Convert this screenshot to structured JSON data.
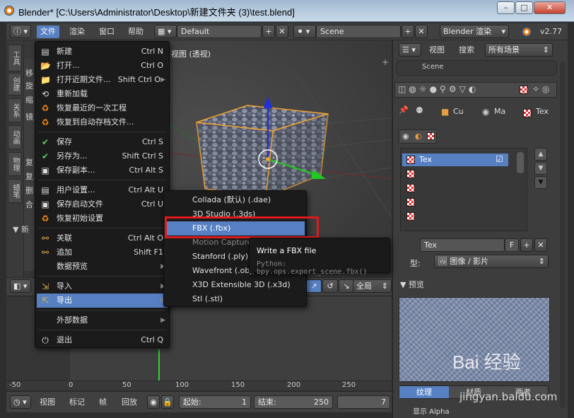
{
  "window": {
    "title": "Blender* [C:\\Users\\Administrator\\Desktop\\新建文件夹 (3)\\test.blend]",
    "min_label": "–",
    "max_label": "□",
    "close_label": "✕"
  },
  "header": {
    "menus": [
      "文件",
      "渲染",
      "窗口",
      "帮助"
    ],
    "layout_name": "Default",
    "scene_name": "Scene",
    "engine": "Blender 渲染",
    "version": "v2.77"
  },
  "left_tabs": [
    "工具",
    "创建",
    "关系",
    "动画",
    "物理",
    "蜡笔"
  ],
  "viewport": {
    "label": "视图 (透视)",
    "bg_items": [
      "移",
      "旋",
      "缩",
      "镜",
      "复",
      "复",
      "删",
      "合"
    ],
    "section_label": "▼ 新"
  },
  "file_menu": {
    "items": [
      {
        "label": "新建",
        "shortcut": "Ctrl N",
        "icon": "new-file-icon"
      },
      {
        "label": "打开...",
        "shortcut": "Ctrl O",
        "icon": "open-folder-icon"
      },
      {
        "label": "打开近期文件...",
        "shortcut": "Shift Ctrl O",
        "icon": "recent-files-icon",
        "submenu": true
      },
      {
        "label": "重新加载",
        "shortcut": "",
        "icon": "reload-icon"
      },
      {
        "label": "恢复最近的一次工程",
        "shortcut": "",
        "icon": "recover-icon"
      },
      {
        "label": "恢复到自动存档文件...",
        "shortcut": "",
        "icon": "recover-auto-icon"
      },
      {
        "label": "保存",
        "shortcut": "Ctrl S",
        "icon": "checkmark-icon"
      },
      {
        "label": "另存为...",
        "shortcut": "Shift Ctrl S",
        "icon": "checkmark-icon"
      },
      {
        "label": "保存副本...",
        "shortcut": "Ctrl Alt S",
        "icon": "save-copy-icon"
      },
      {
        "label": "用户设置...",
        "shortcut": "Ctrl Alt U",
        "icon": "preferences-icon"
      },
      {
        "label": "保存启动文件",
        "shortcut": "Ctrl U",
        "icon": "save-startup-icon"
      },
      {
        "label": "恢复初始设置",
        "shortcut": "",
        "icon": "factory-settings-icon"
      },
      {
        "label": "关联",
        "shortcut": "Ctrl Alt O",
        "icon": "link-icon"
      },
      {
        "label": "追加",
        "shortcut": "Shift F1",
        "icon": "append-icon"
      },
      {
        "label": "数据预览",
        "shortcut": "",
        "icon": "",
        "submenu": true
      },
      {
        "label": "导入",
        "shortcut": "",
        "icon": "import-icon",
        "submenu": true
      },
      {
        "label": "导出",
        "shortcut": "",
        "icon": "export-icon",
        "submenu": true,
        "active": true
      },
      {
        "label": "外部数据",
        "shortcut": "",
        "icon": "",
        "submenu": true
      },
      {
        "label": "退出",
        "shortcut": "Ctrl Q",
        "icon": "quit-icon"
      }
    ]
  },
  "export_menu": {
    "items": [
      {
        "label": "Collada (默认) (.dae)"
      },
      {
        "label": "3D Studio (.3ds)"
      },
      {
        "label": "FBX (.fbx)",
        "active": true
      },
      {
        "label": "Motion Capture (.bvh)",
        "disabled": true
      },
      {
        "label": "Stanford (.ply)"
      },
      {
        "label": "Wavefront (.obj)"
      },
      {
        "label": "X3D Extensible 3D (.x3d)"
      },
      {
        "label": "Stl (.stl)"
      }
    ]
  },
  "tooltip": {
    "title": "Write a FBX file",
    "python": "Python: bpy.ops.export_scene.fbx()"
  },
  "viewport_header": {
    "mode": "全局"
  },
  "timeline": {
    "ruler_ticks": [
      "-50",
      "0",
      "50",
      "100",
      "150",
      "200",
      "250"
    ],
    "footer_menus": [
      "视图",
      "标记",
      "帧",
      "回放"
    ],
    "start_label": "起始:",
    "start_value": "1",
    "end_label": "结束:",
    "end_value": "250",
    "current_frame": "7"
  },
  "properties": {
    "header_menus": [
      "视图",
      "搜索"
    ],
    "filter": "所有场景",
    "scene_item": "Scene",
    "breadcrumb": [
      "Cu",
      "Ma",
      "Tex"
    ],
    "texture_slot": "Tex",
    "texture_name": "Tex",
    "fake_user": "F",
    "type_label": "型:",
    "type_value": "图像 / 影片",
    "preview_label": "▼ 预览",
    "preview_tabs": [
      "纹理",
      "材质",
      "两者"
    ],
    "bottom_label": "显示 Alpha"
  },
  "watermark": {
    "brand": "Bai 经验",
    "url": "jingyan.baidu.com"
  }
}
